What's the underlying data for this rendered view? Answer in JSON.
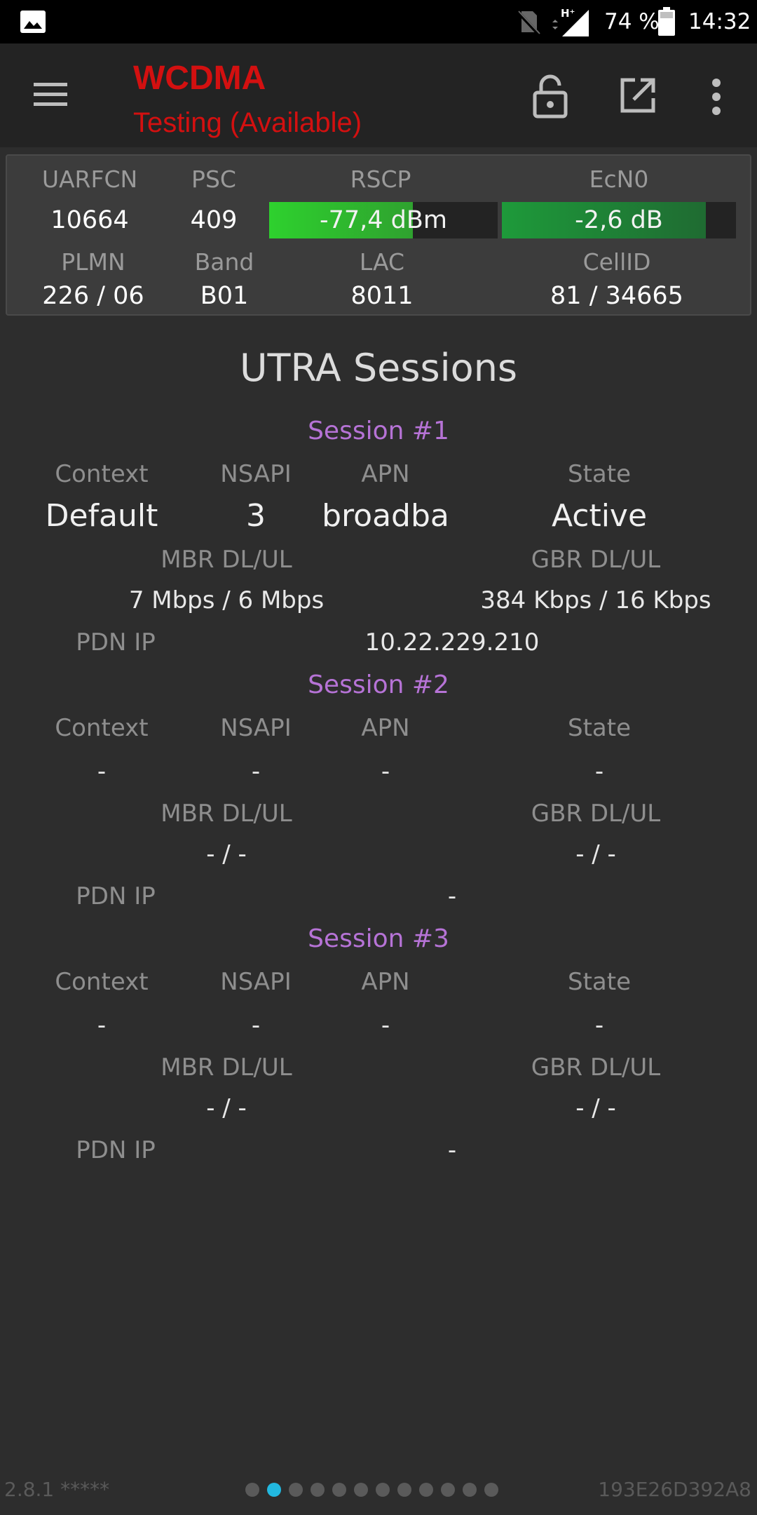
{
  "status_bar": {
    "battery_percent": "74 %",
    "time": "14:32",
    "icons": [
      "gallery-icon",
      "no-sim-icon",
      "network-hplus-icon",
      "battery-icon"
    ]
  },
  "toolbar": {
    "title": "WCDMA",
    "subtitle": "Testing (Available)",
    "icons": [
      "menu-icon",
      "lock-icon",
      "open-external-icon",
      "more-vert-icon"
    ]
  },
  "panel": {
    "uarfcn_label": "UARFCN",
    "uarfcn": "10664",
    "psc_label": "PSC",
    "psc": "409",
    "rscp_label": "RSCP",
    "rscp": "-77,4 dBm",
    "rscp_level": 0.63,
    "rscp_color": "#2ed12e",
    "ecn0_label": "EcN0",
    "ecn0": "-2,6 dB",
    "ecn0_level": 0.87,
    "ecn0_color": "#1e9a3a",
    "plmn_label": "PLMN",
    "plmn": "226 / 06",
    "band_label": "Band",
    "band": "B01",
    "lac_label": "LAC",
    "lac": "8011",
    "cellid_label": "CellID",
    "cellid": "81 / 34665"
  },
  "sessions_title": "UTRA Sessions",
  "labels": {
    "context": "Context",
    "nsapi": "NSAPI",
    "apn": "APN",
    "state": "State",
    "mbr": "MBR DL/UL",
    "gbr": "GBR DL/UL",
    "pdn_ip": "PDN IP"
  },
  "sessions": [
    {
      "title": "Session #1",
      "context": "Default",
      "nsapi": "3",
      "apn": "broadba",
      "state": "Active",
      "mbr": "7 Mbps / 6 Mbps",
      "gbr": "384 Kbps / 16 Kbps",
      "pdn_ip": "10.22.229.210"
    },
    {
      "title": "Session #2",
      "context": "-",
      "nsapi": "-",
      "apn": "-",
      "state": "-",
      "mbr": "- / -",
      "gbr": "- / -",
      "pdn_ip": "-"
    },
    {
      "title": "Session #3",
      "context": "-",
      "nsapi": "-",
      "apn": "-",
      "state": "-",
      "mbr": "- / -",
      "gbr": "- / -",
      "pdn_ip": "-"
    }
  ],
  "footer": {
    "version": "2.8.1 *****",
    "device_id": "193E26D392A8",
    "page_count": 12,
    "active_page": 2
  }
}
